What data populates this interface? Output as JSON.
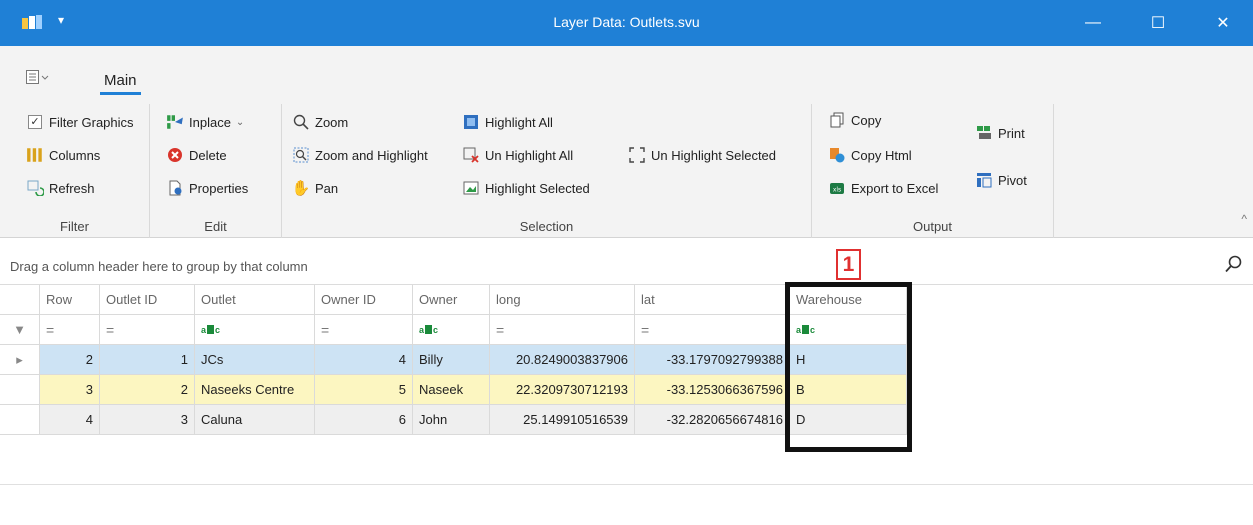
{
  "window": {
    "title": "Layer Data: Outlets.svu",
    "qat_glyph": "▾",
    "controls": {
      "minimize": "—",
      "maximize": "☐",
      "close": "✕"
    }
  },
  "ribbon": {
    "tab_main": "Main",
    "collapse_glyph": "^",
    "groups": {
      "filter": {
        "label": "Filter",
        "filter_graphics": "Filter Graphics",
        "filter_graphics_checked": true,
        "columns": "Columns",
        "refresh": "Refresh"
      },
      "edit": {
        "label": "Edit",
        "inplace": "Inplace",
        "delete": "Delete",
        "properties": "Properties"
      },
      "selection": {
        "label": "Selection",
        "zoom": "Zoom",
        "zoom_and_highlight": "Zoom and Highlight",
        "pan": "Pan",
        "highlight_all": "Highlight All",
        "un_highlight_all": "Un Highlight All",
        "highlight_selected": "Highlight Selected",
        "un_highlight_selected": "Un Highlight Selected"
      },
      "output": {
        "label": "Output",
        "copy": "Copy",
        "copy_html": "Copy Html",
        "export_to_excel": "Export to Excel",
        "print": "Print",
        "pivot": "Pivot"
      }
    }
  },
  "group_panel": {
    "hint": "Drag a column header here to group by that column"
  },
  "grid": {
    "columns": [
      "Row",
      "Outlet ID",
      "Outlet",
      "Owner ID",
      "Owner",
      "long",
      "lat",
      "Warehouse"
    ],
    "filter_row": [
      "=",
      "=",
      "abc",
      "=",
      "abc",
      "=",
      "=",
      "abc"
    ],
    "rows": [
      {
        "row": "2",
        "outlet_id": "1",
        "outlet": "JCs",
        "owner_id": "4",
        "owner": "Billy",
        "long": "20.8249003837906",
        "lat": "-33.1797092799388",
        "warehouse": "H"
      },
      {
        "row": "3",
        "outlet_id": "2",
        "outlet": "Naseeks Centre",
        "owner_id": "5",
        "owner": "Naseek",
        "long": "22.3209730712193",
        "lat": "-33.1253066367596",
        "warehouse": "B"
      },
      {
        "row": "4",
        "outlet_id": "3",
        "outlet": "Caluna",
        "owner_id": "6",
        "owner": "John",
        "long": "25.149910516539",
        "lat": "-32.2820656674816",
        "warehouse": "D"
      }
    ],
    "focused_row_glyph": "▸",
    "filter_row_glyph": "▼"
  },
  "annotation": {
    "number": "1",
    "color": "#e03030"
  },
  "colors": {
    "titlebar": "#1f80d6",
    "row_selected": "#cde3f4",
    "row_highlight": "#fcf6c1"
  }
}
